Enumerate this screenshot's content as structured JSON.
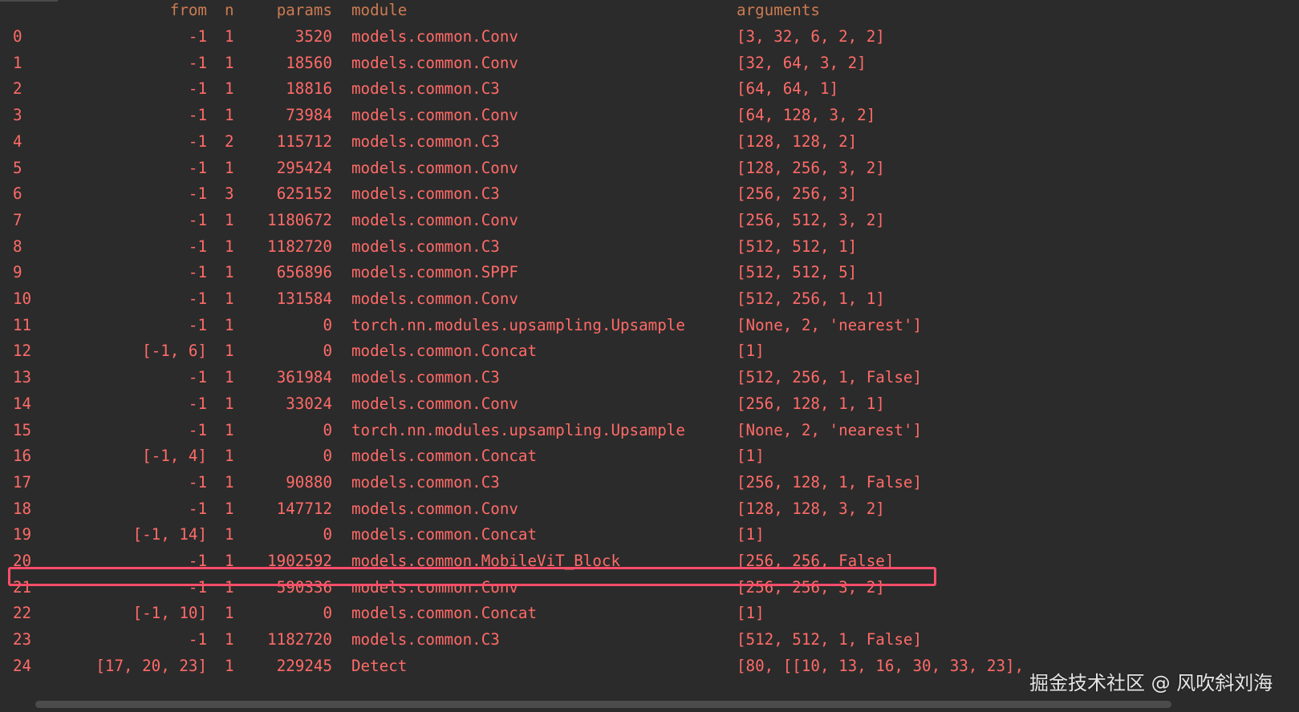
{
  "header": {
    "from": "from",
    "n": "n",
    "params": "params",
    "module": "module",
    "arguments": "arguments"
  },
  "rows": [
    {
      "idx": "0",
      "from": "-1",
      "n": "1",
      "params": "3520",
      "module": "models.common.Conv",
      "arguments": "[3, 32, 6, 2, 2]"
    },
    {
      "idx": "1",
      "from": "-1",
      "n": "1",
      "params": "18560",
      "module": "models.common.Conv",
      "arguments": "[32, 64, 3, 2]"
    },
    {
      "idx": "2",
      "from": "-1",
      "n": "1",
      "params": "18816",
      "module": "models.common.C3",
      "arguments": "[64, 64, 1]"
    },
    {
      "idx": "3",
      "from": "-1",
      "n": "1",
      "params": "73984",
      "module": "models.common.Conv",
      "arguments": "[64, 128, 3, 2]"
    },
    {
      "idx": "4",
      "from": "-1",
      "n": "2",
      "params": "115712",
      "module": "models.common.C3",
      "arguments": "[128, 128, 2]"
    },
    {
      "idx": "5",
      "from": "-1",
      "n": "1",
      "params": "295424",
      "module": "models.common.Conv",
      "arguments": "[128, 256, 3, 2]"
    },
    {
      "idx": "6",
      "from": "-1",
      "n": "3",
      "params": "625152",
      "module": "models.common.C3",
      "arguments": "[256, 256, 3]"
    },
    {
      "idx": "7",
      "from": "-1",
      "n": "1",
      "params": "1180672",
      "module": "models.common.Conv",
      "arguments": "[256, 512, 3, 2]"
    },
    {
      "idx": "8",
      "from": "-1",
      "n": "1",
      "params": "1182720",
      "module": "models.common.C3",
      "arguments": "[512, 512, 1]"
    },
    {
      "idx": "9",
      "from": "-1",
      "n": "1",
      "params": "656896",
      "module": "models.common.SPPF",
      "arguments": "[512, 512, 5]"
    },
    {
      "idx": "10",
      "from": "-1",
      "n": "1",
      "params": "131584",
      "module": "models.common.Conv",
      "arguments": "[512, 256, 1, 1]"
    },
    {
      "idx": "11",
      "from": "-1",
      "n": "1",
      "params": "0",
      "module": "torch.nn.modules.upsampling.Upsample",
      "arguments": "[None, 2, 'nearest']"
    },
    {
      "idx": "12",
      "from": "[-1, 6]",
      "n": "1",
      "params": "0",
      "module": "models.common.Concat",
      "arguments": "[1]"
    },
    {
      "idx": "13",
      "from": "-1",
      "n": "1",
      "params": "361984",
      "module": "models.common.C3",
      "arguments": "[512, 256, 1, False]"
    },
    {
      "idx": "14",
      "from": "-1",
      "n": "1",
      "params": "33024",
      "module": "models.common.Conv",
      "arguments": "[256, 128, 1, 1]"
    },
    {
      "idx": "15",
      "from": "-1",
      "n": "1",
      "params": "0",
      "module": "torch.nn.modules.upsampling.Upsample",
      "arguments": "[None, 2, 'nearest']"
    },
    {
      "idx": "16",
      "from": "[-1, 4]",
      "n": "1",
      "params": "0",
      "module": "models.common.Concat",
      "arguments": "[1]"
    },
    {
      "idx": "17",
      "from": "-1",
      "n": "1",
      "params": "90880",
      "module": "models.common.C3",
      "arguments": "[256, 128, 1, False]"
    },
    {
      "idx": "18",
      "from": "-1",
      "n": "1",
      "params": "147712",
      "module": "models.common.Conv",
      "arguments": "[128, 128, 3, 2]"
    },
    {
      "idx": "19",
      "from": "[-1, 14]",
      "n": "1",
      "params": "0",
      "module": "models.common.Concat",
      "arguments": "[1]"
    },
    {
      "idx": "20",
      "from": "-1",
      "n": "1",
      "params": "1902592",
      "module": "models.common.MobileViT_Block",
      "arguments": "[256, 256, False]"
    },
    {
      "idx": "21",
      "from": "-1",
      "n": "1",
      "params": "590336",
      "module": "models.common.Conv",
      "arguments": "[256, 256, 3, 2]"
    },
    {
      "idx": "22",
      "from": "[-1, 10]",
      "n": "1",
      "params": "0",
      "module": "models.common.Concat",
      "arguments": "[1]"
    },
    {
      "idx": "23",
      "from": "-1",
      "n": "1",
      "params": "1182720",
      "module": "models.common.C3",
      "arguments": "[512, 512, 1, False]"
    },
    {
      "idx": "24",
      "from": "[17, 20, 23]",
      "n": "1",
      "params": "229245",
      "module": "Detect",
      "arguments": "[80, [[10, 13, 16, 30, 33, 23],"
    }
  ],
  "highlighted_row_index": "20",
  "watermark": "掘金技术社区 @ 风吹斜刘海",
  "colors": {
    "background": "#2b2b2b",
    "text": "#ff6b68",
    "highlight_border": "#ff4d6a"
  }
}
